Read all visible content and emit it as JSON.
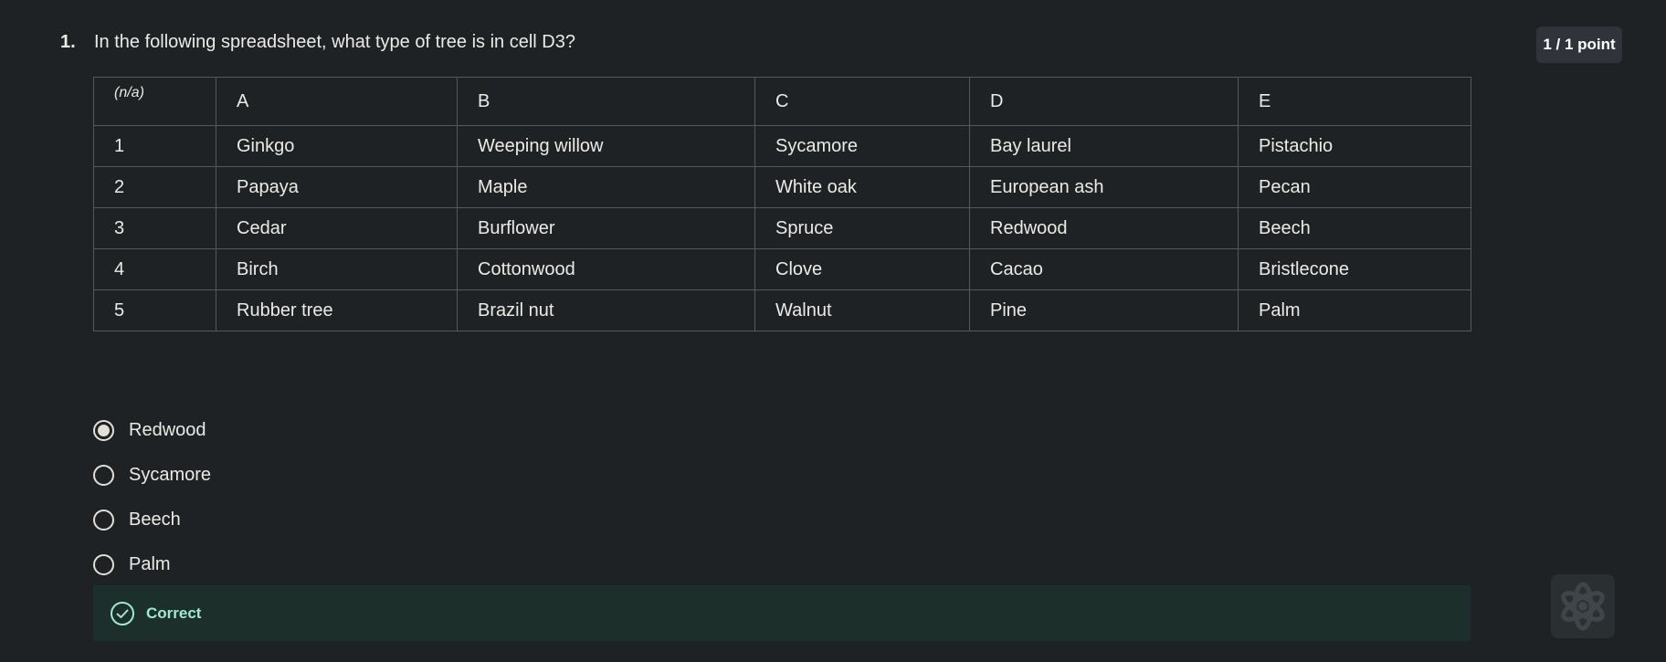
{
  "question": {
    "number": "1.",
    "text": "In the following spreadsheet, what type of tree is in cell D3?",
    "points": "1 / 1 point"
  },
  "spreadsheet": {
    "corner": "(n/a)",
    "columns": [
      "A",
      "B",
      "C",
      "D",
      "E"
    ],
    "rows": [
      {
        "label": "1",
        "cells": [
          "Ginkgo",
          "Weeping willow",
          "Sycamore",
          "Bay laurel",
          "Pistachio"
        ]
      },
      {
        "label": "2",
        "cells": [
          "Papaya",
          "Maple",
          "White oak",
          "European ash",
          "Pecan"
        ]
      },
      {
        "label": "3",
        "cells": [
          "Cedar",
          "Burflower",
          "Spruce",
          "Redwood",
          "Beech"
        ]
      },
      {
        "label": "4",
        "cells": [
          "Birch",
          "Cottonwood",
          "Clove",
          "Cacao",
          "Bristlecone"
        ]
      },
      {
        "label": "5",
        "cells": [
          "Rubber tree",
          "Brazil nut",
          "Walnut",
          "Pine",
          "Palm"
        ]
      }
    ]
  },
  "options": [
    {
      "label": "Redwood",
      "selected": true
    },
    {
      "label": "Sycamore",
      "selected": false
    },
    {
      "label": "Beech",
      "selected": false
    },
    {
      "label": "Palm",
      "selected": false
    }
  ],
  "feedback": {
    "text": "Correct",
    "icon": "check-circle-icon"
  },
  "assistant": {
    "icon": "ai-assistant-icon"
  },
  "colors": {
    "background": "#1f2224",
    "feedback_bg": "#1c2f2a",
    "feedback_text": "#9fe8d4",
    "badge_bg": "#30343a"
  }
}
